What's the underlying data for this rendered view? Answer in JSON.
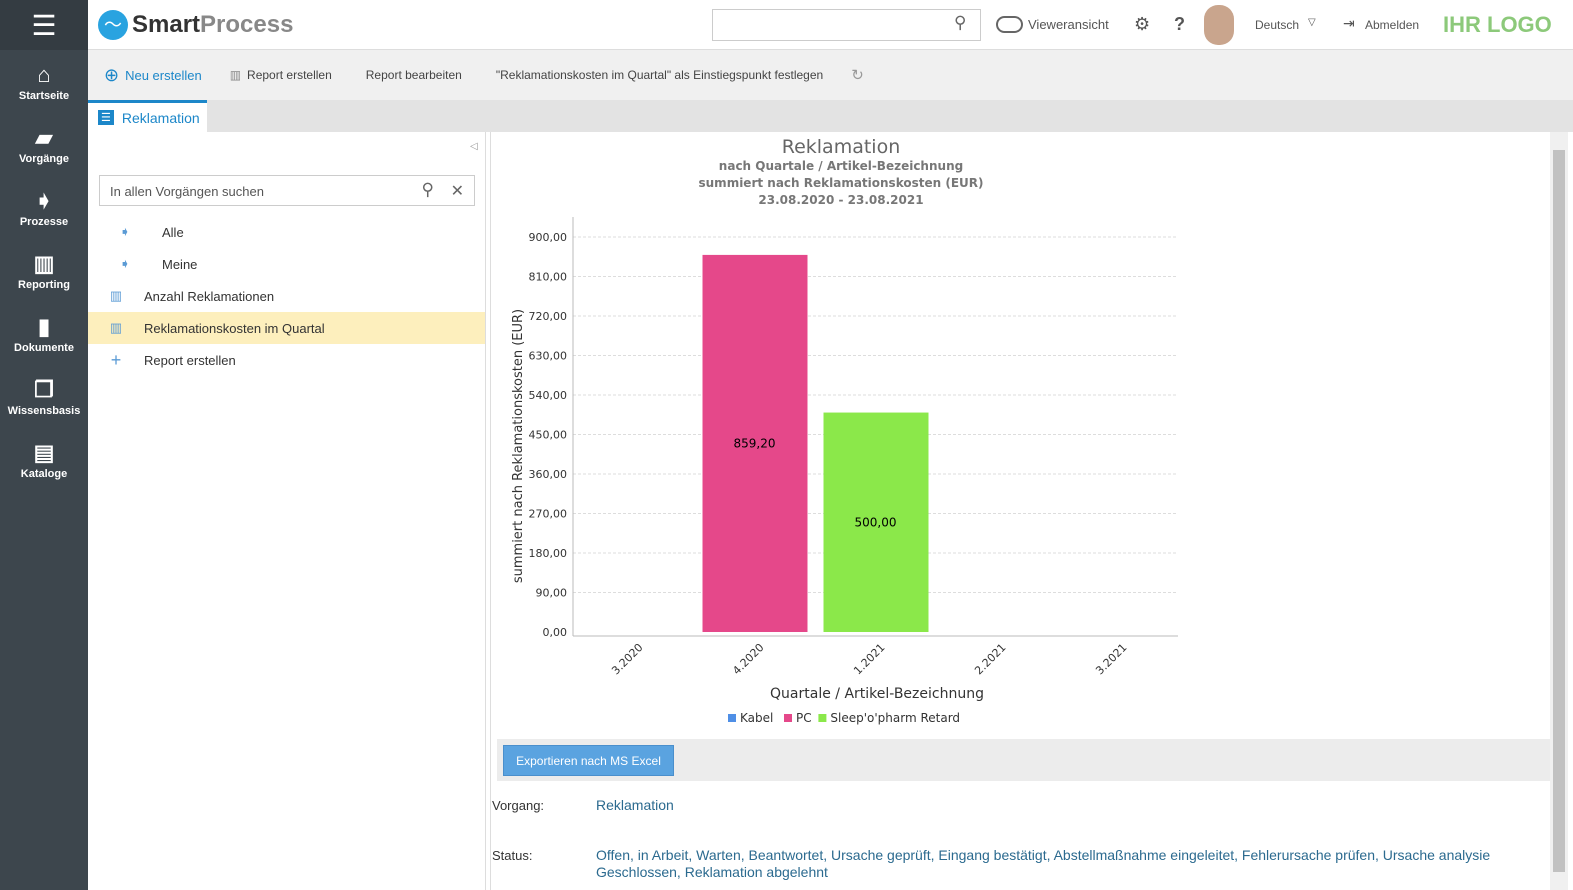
{
  "app": {
    "logo_text_a": "Smart",
    "logo_text_b": "Process",
    "brand_logo": "IHR LOGO"
  },
  "sidebar": {
    "items": [
      {
        "label": "Startseite",
        "icon": "home-icon"
      },
      {
        "label": "Vorgänge",
        "icon": "folder-icon"
      },
      {
        "label": "Prozesse",
        "icon": "process-icon"
      },
      {
        "label": "Reporting",
        "icon": "chart-icon"
      },
      {
        "label": "Dokumente",
        "icon": "document-icon"
      },
      {
        "label": "Wissensbasis",
        "icon": "copy-icon"
      },
      {
        "label": "Kataloge",
        "icon": "book-icon"
      }
    ]
  },
  "header": {
    "search_placeholder": "",
    "viewer_label": "Vieweransicht",
    "language": "Deutsch",
    "logout": "Abmelden"
  },
  "toolbar": {
    "new": "Neu erstellen",
    "create_report": "Report erstellen",
    "edit_report": "Report bearbeiten",
    "set_entry": "\"Reklamationskosten im Quartal\" als Einstiegspunkt festlegen"
  },
  "tab": {
    "label": "Reklamation"
  },
  "left": {
    "search_placeholder": "In allen Vorgängen suchen",
    "items": [
      {
        "label": "Alle"
      },
      {
        "label": "Meine"
      },
      {
        "label": "Anzahl Reklamationen"
      },
      {
        "label": "Reklamationskosten im Quartal"
      },
      {
        "label": "Report erstellen"
      }
    ]
  },
  "chart_data": {
    "type": "bar",
    "title": "Reklamation",
    "subtitles": [
      "nach Quartale / Artikel-Bezeichnung",
      "summiert nach Reklamationskosten (EUR)",
      "23.08.2020 - 23.08.2021"
    ],
    "xlabel": "Quartale / Artikel-Bezeichnung",
    "ylabel": "summiert nach Reklamationskosten (EUR)",
    "categories": [
      "3.2020",
      "4.2020",
      "1.2021",
      "2.2021",
      "3.2021"
    ],
    "yticks": [
      "0,00",
      "90,00",
      "180,00",
      "270,00",
      "360,00",
      "450,00",
      "540,00",
      "630,00",
      "720,00",
      "810,00",
      "900,00"
    ],
    "ylim": [
      0,
      900
    ],
    "grid": true,
    "legend": "bottom",
    "series": [
      {
        "name": "Kabel",
        "color": "#4f8fe6",
        "values": [
          0,
          0,
          0,
          0,
          0
        ]
      },
      {
        "name": "PC",
        "color": "#e5488a",
        "values": [
          0,
          859.2,
          0,
          0,
          0
        ]
      },
      {
        "name": "Sleep'o'pharm Retard",
        "color": "#8be84a",
        "values": [
          0,
          0,
          500,
          0,
          0
        ]
      }
    ],
    "data_labels": {
      "PC": "859,20",
      "Sleep'o'pharm Retard": "500,00"
    }
  },
  "export": "Exportieren nach MS Excel",
  "details": {
    "vorgang_label": "Vorgang:",
    "vorgang": "Reklamation",
    "status_label": "Status:",
    "status_line1": "Offen, in Arbeit, Warten, Beantwortet, Ursache geprüft, Eingang bestätigt, Abstellmaßnahme eingeleitet, Fehlerursache prüfen, Ursache analysie",
    "status_line2": "Geschlossen, Reklamation abgelehnt"
  }
}
